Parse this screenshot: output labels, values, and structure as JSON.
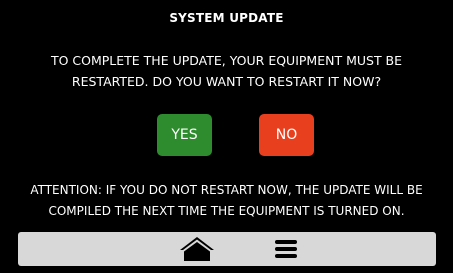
{
  "dialog": {
    "title": "SYSTEM UPDATE",
    "message": "TO COMPLETE THE UPDATE, YOUR EQUIPMENT MUST BE RESTARTED. DO YOU WANT TO RESTART IT NOW?",
    "attention": "ATTENTION: IF YOU DO NOT RESTART NOW, THE UPDATE WILL BE COMPILED THE NEXT TIME THE EQUIPMENT IS TURNED ON."
  },
  "buttons": {
    "yes_label": "YES",
    "no_label": "NO",
    "yes_color": "#2e8b2e",
    "no_color": "#e8401f"
  },
  "bottom_bar": {
    "home_icon": "home-icon",
    "menu_icon": "hamburger-menu-icon"
  }
}
